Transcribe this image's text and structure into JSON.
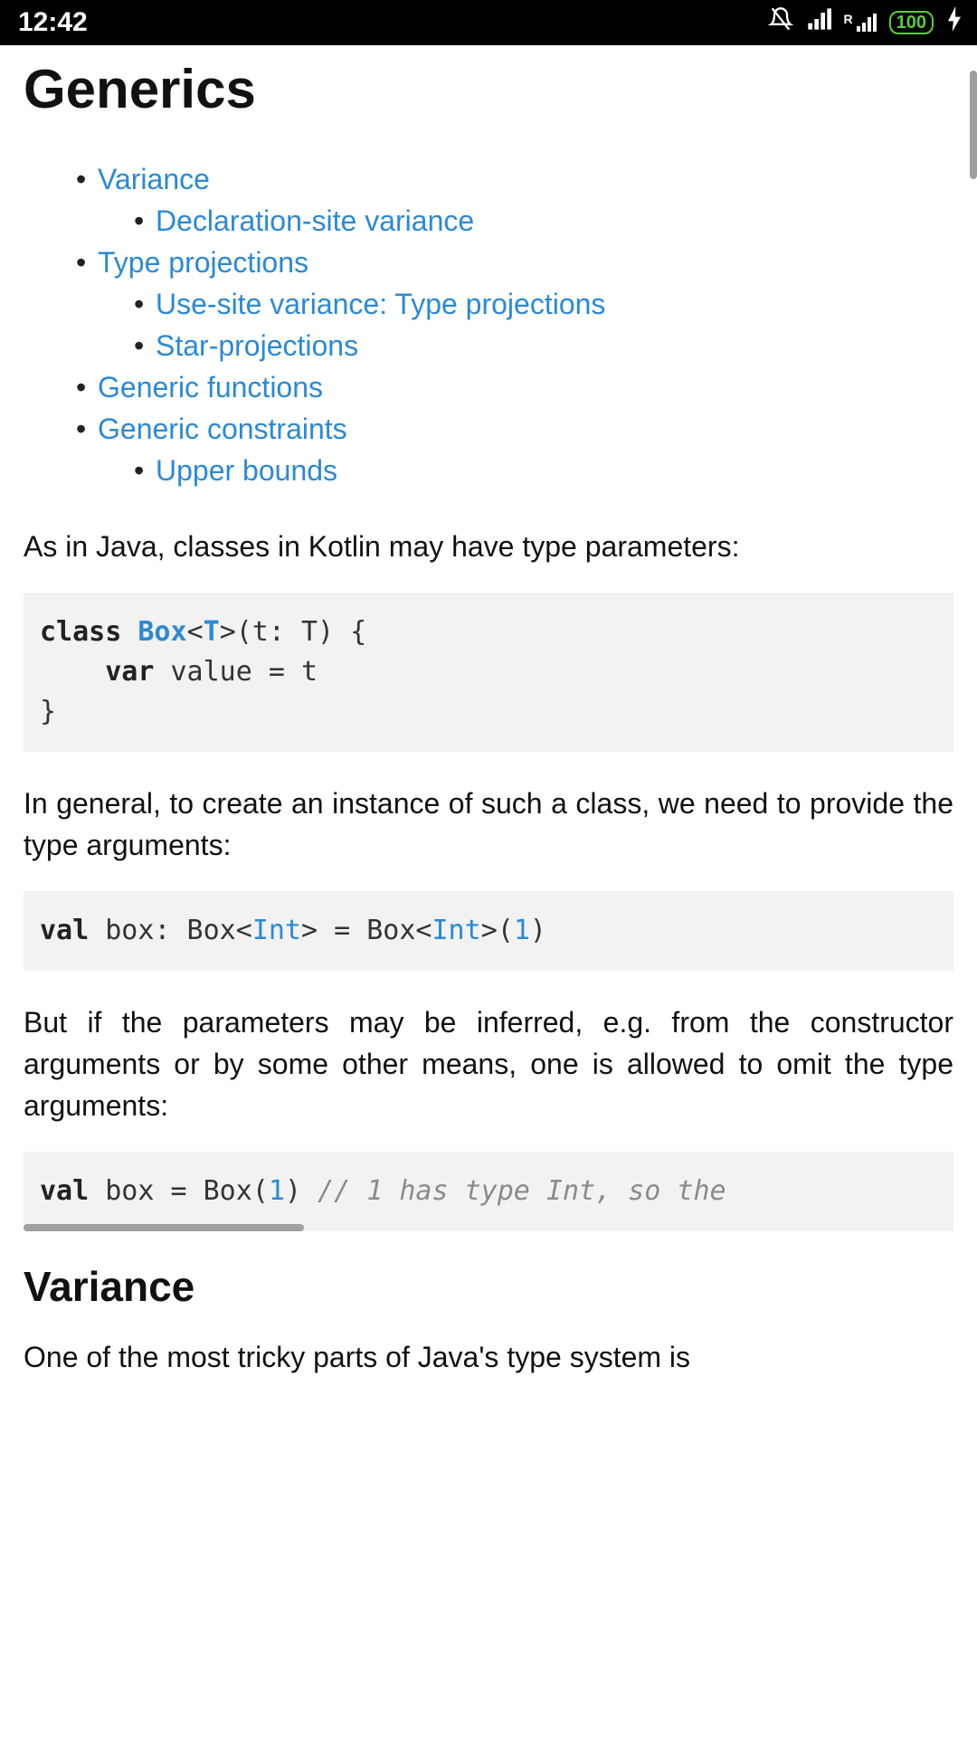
{
  "statusbar": {
    "time": "12:42",
    "battery": "100"
  },
  "page": {
    "title": "Generics",
    "variance_heading": "Variance"
  },
  "toc": {
    "variance": "Variance",
    "decl_site": "Declaration-site variance",
    "type_proj": "Type projections",
    "use_site": "Use-site variance: Type projections",
    "star_proj": "Star-projections",
    "generic_fn": "Generic functions",
    "generic_con": "Generic constraints",
    "upper": "Upper bounds"
  },
  "para": {
    "p1": "As in Java, classes in Kotlin may have type parameters:",
    "p2": "In general, to create an instance of such a class, we need to provide the type arguments:",
    "p3": "But if the parameters may be inferred, e.g. from the constructor arguments or by some other means, one is allowed to omit the type arguments:",
    "p4": "One of the most tricky parts of Java's type system is"
  },
  "code1": {
    "kw_class": "class",
    "cls_box": "Box",
    "lt": "<",
    "tparam": "T",
    "gt_open": ">(t: T) {",
    "indent": "    ",
    "kw_var": "var",
    "rest_line2": " value = t",
    "close": "}"
  },
  "code2": {
    "kw_val": "val",
    "a": " box: Box<",
    "int1": "Int",
    "b": "> = Box<",
    "int2": "Int",
    "c": ">(",
    "one": "1",
    "d": ")"
  },
  "code3": {
    "kw_val": "val",
    "a": " box = Box(",
    "one": "1",
    "b": ") ",
    "comment": "// 1 has type Int, so the"
  }
}
